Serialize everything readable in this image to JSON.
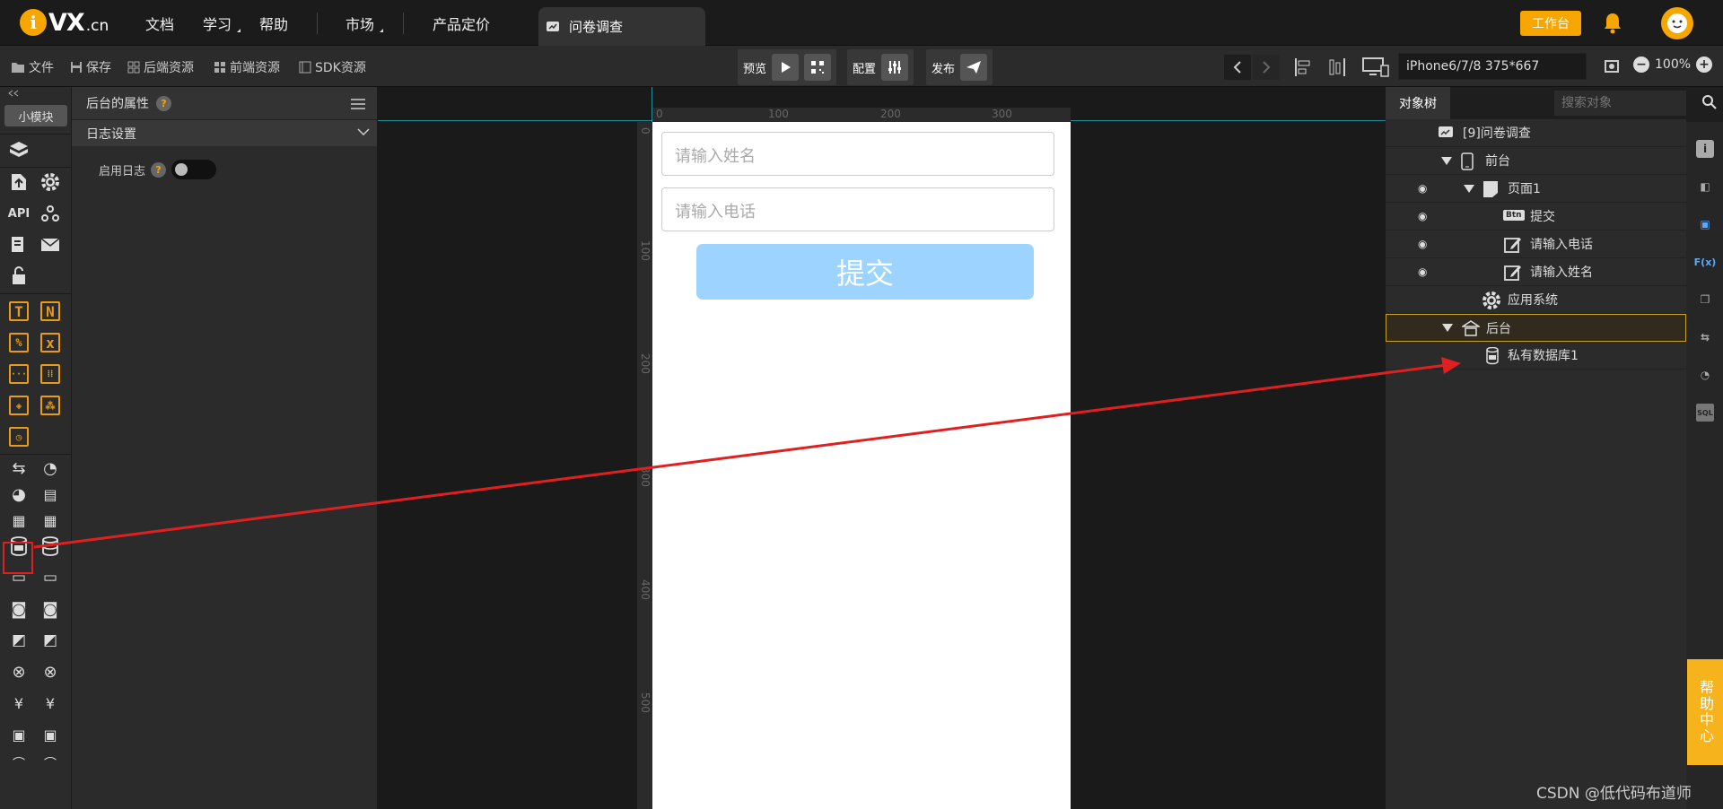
{
  "brand": {
    "logo_mark": "i",
    "logo_text": "VX",
    "logo_domain": ".cn"
  },
  "nav": [
    {
      "label": "文档"
    },
    {
      "label": "学习"
    },
    {
      "label": "帮助"
    },
    {
      "label": "市场"
    },
    {
      "label": "产品定价"
    }
  ],
  "active_tab": {
    "label": "问卷调查"
  },
  "header": {
    "workbench": "工作台"
  },
  "toolbar": {
    "file": "文件",
    "save": "保存",
    "backend_res": "后端资源",
    "frontend_res": "前端资源",
    "sdk_res": "SDK资源",
    "preview": "预览",
    "config": "配置",
    "publish": "发布",
    "device": "iPhone6/7/8 375*667",
    "zoom": "100%"
  },
  "iconbar": {
    "small_module": "小模块",
    "api": "API"
  },
  "props": {
    "title": "后台的属性",
    "section": "日志设置",
    "log_label": "启用日志",
    "log_enabled": false
  },
  "canvas": {
    "ruler_h": [
      "0",
      "100",
      "200",
      "300"
    ],
    "ruler_v": [
      "0",
      "100",
      "200",
      "300",
      "400",
      "500"
    ],
    "name_placeholder": "请输入姓名",
    "phone_placeholder": "请输入电话",
    "submit_label": "提交"
  },
  "tree": {
    "title": "对象树",
    "search_placeholder": "搜索对象",
    "nodes": [
      {
        "label": "[9]问卷调查"
      },
      {
        "label": "前台"
      },
      {
        "label": "页面1"
      },
      {
        "label": "提交"
      },
      {
        "label": "请输入电话"
      },
      {
        "label": "请输入姓名"
      },
      {
        "label": "应用系统"
      },
      {
        "label": "后台"
      },
      {
        "label": "私有数据库1"
      }
    ]
  },
  "farbar": {
    "fx": "F(x)",
    "sql": "SQL"
  },
  "help_center": "帮助中心",
  "watermark": "CSDN @低代码布道师",
  "colors": {
    "brand": "#f7a600",
    "submit": "#9dd4ff",
    "highlight": "#e02020",
    "selected_border": "#c9a227"
  }
}
